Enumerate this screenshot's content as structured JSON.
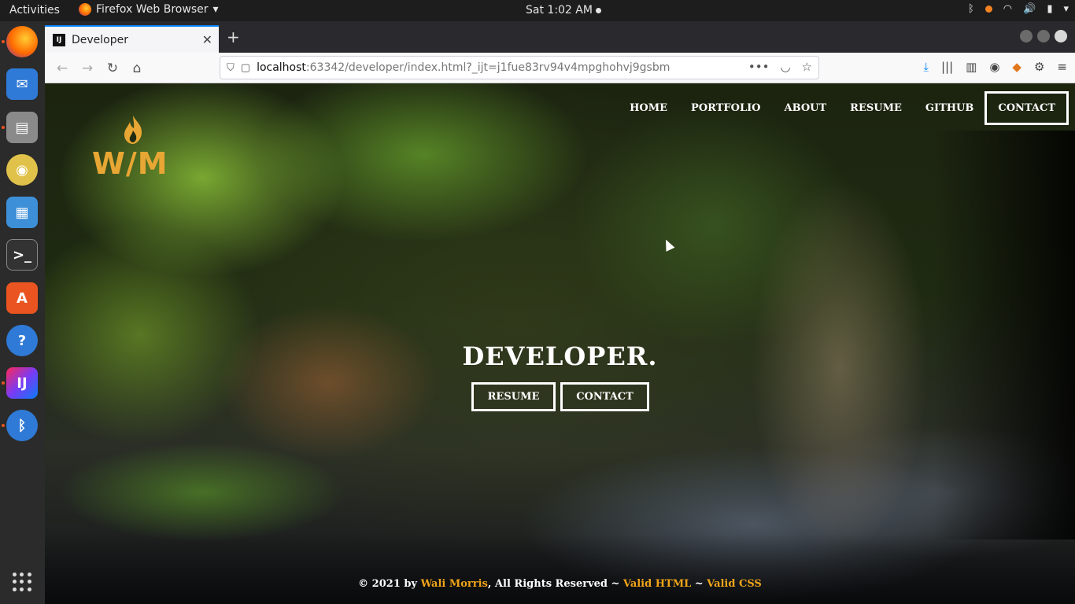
{
  "system": {
    "activities": "Activities",
    "app_menu": "Firefox Web Browser",
    "clock": "Sat  1:02 AM"
  },
  "dock": {
    "items": [
      "firefox-icon",
      "thunderbird-icon",
      "files-icon",
      "rhythmbox-icon",
      "libreoffice-writer-icon",
      "terminal-icon",
      "software-center-icon",
      "help-icon",
      "intellij-icon",
      "bluetooth-icon"
    ]
  },
  "browser": {
    "tab_title": "Developer",
    "tab_favicon": "IJ",
    "url_host": "localhost",
    "url_rest": ":63342/developer/index.html?_ijt=j1fue83rv94v4mpghohvj9gsbm"
  },
  "site": {
    "logo_text": "W/M",
    "nav": [
      "HOME",
      "PORTFOLIO",
      "ABOUT",
      "RESUME",
      "GITHUB",
      "CONTACT"
    ],
    "hero_title": "DEVELOPER.",
    "hero_buttons": [
      "RESUME",
      "CONTACT"
    ],
    "footer": {
      "prefix": "© 2021 by ",
      "author": "Wali Morris",
      "middle": ", All Rights Reserved ~ ",
      "valid_html": "Valid HTML",
      "sep": " ~ ",
      "valid_css": "Valid CSS"
    },
    "accent_color": "#f0a419"
  }
}
